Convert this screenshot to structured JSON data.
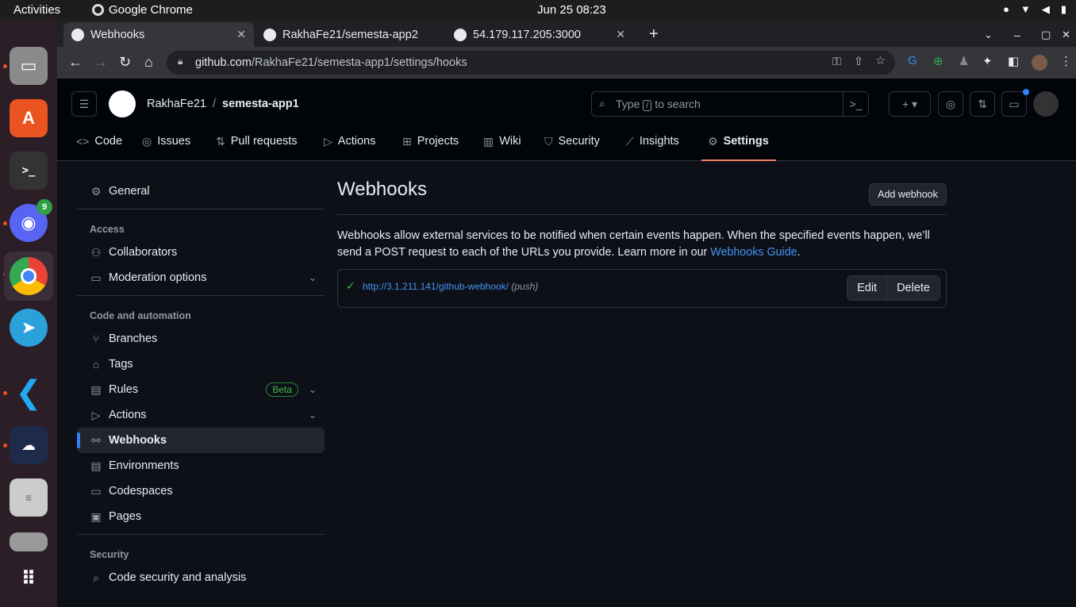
{
  "system": {
    "activities": "Activities",
    "app_name": "Google Chrome",
    "clock": "Jun 25  08:23"
  },
  "dock": {
    "discord_badge": "9"
  },
  "browser": {
    "tabs": [
      {
        "title": "Webhooks"
      },
      {
        "title": "RakhaFe21/semesta-app2"
      },
      {
        "title": "54.179.117.205:3000"
      }
    ],
    "url_host": "github.com",
    "url_path": "/RakhaFe21/semesta-app1/settings/hooks"
  },
  "github": {
    "owner": "RakhaFe21",
    "separator": "/",
    "repo": "semesta-app1",
    "search": {
      "prefix": "Type",
      "key": "/",
      "suffix": "to search"
    },
    "repo_nav": [
      "Code",
      "Issues",
      "Pull requests",
      "Actions",
      "Projects",
      "Wiki",
      "Security",
      "Insights",
      "Settings"
    ],
    "sidebar": {
      "general": "General",
      "access_heading": "Access",
      "collaborators": "Collaborators",
      "moderation": "Moderation options",
      "code_heading": "Code and automation",
      "branches": "Branches",
      "tags": "Tags",
      "rules": "Rules",
      "beta": "Beta",
      "actions": "Actions",
      "webhooks": "Webhooks",
      "environments": "Environments",
      "codespaces": "Codespaces",
      "pages": "Pages",
      "security_heading": "Security",
      "code_security": "Code security and analysis"
    },
    "main": {
      "title": "Webhooks",
      "add_button": "Add webhook",
      "desc_1": "Webhooks allow external services to be notified when certain events happen. When the specified events happen, we’ll send a POST request to each of the URLs you provide. Learn more in our ",
      "desc_link": "Webhooks Guide",
      "desc_2": ".",
      "hook_url": "http://3.1.211.141/github-webhook/",
      "hook_events": "(push)",
      "edit": "Edit",
      "delete": "Delete"
    }
  }
}
